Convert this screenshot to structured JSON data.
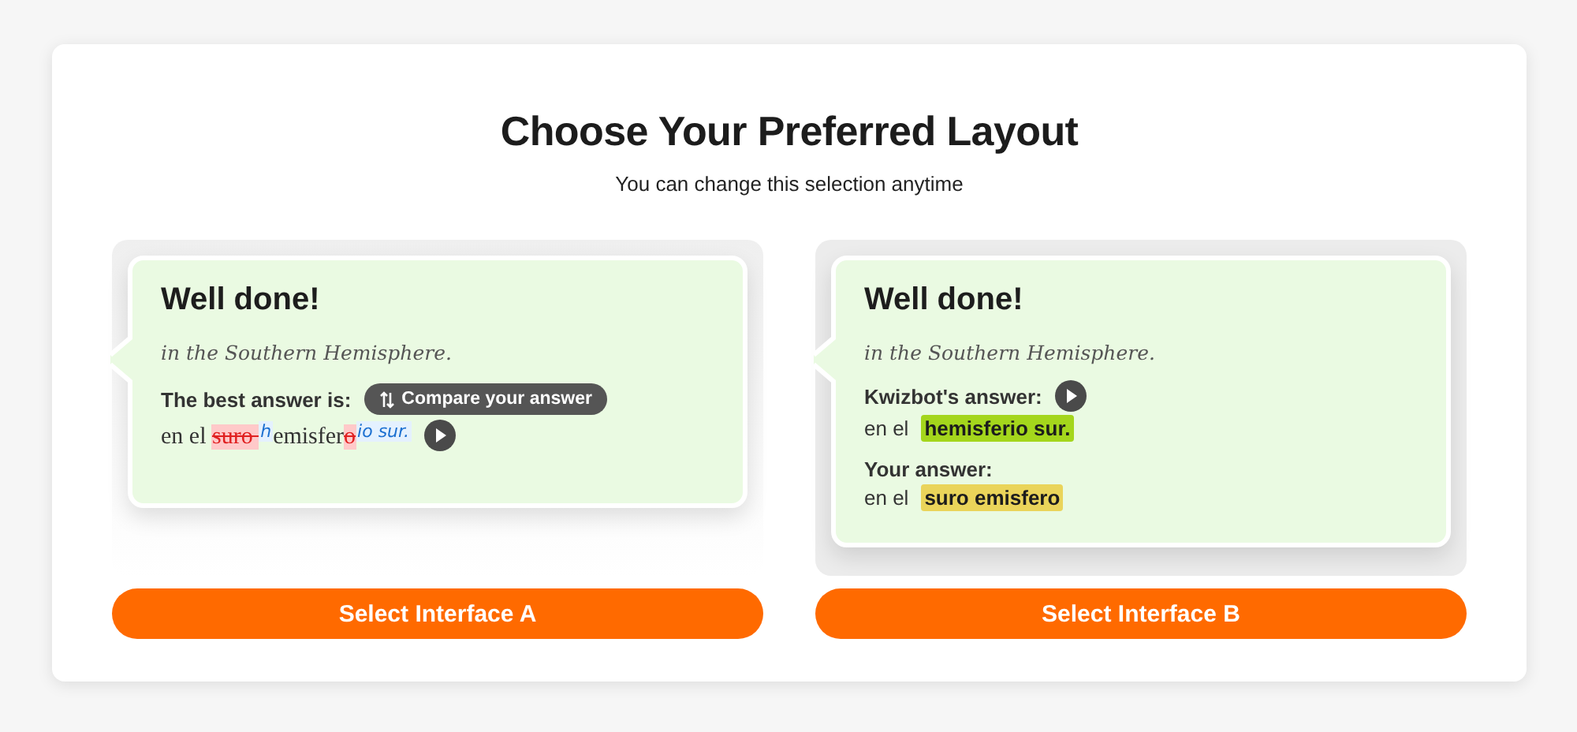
{
  "title": "Choose Your Preferred Layout",
  "subtitle": "You can change this selection anytime",
  "options": [
    {
      "kind": "inline",
      "heading": "Well done!",
      "prompt": "in the Southern Hemisphere.",
      "label": "The best answer is:",
      "compare_button": "Compare your answer",
      "segments": [
        {
          "text": "en el ",
          "kind": "plain"
        },
        {
          "text": "suro ",
          "kind": "deleted"
        },
        {
          "text": "h",
          "kind": "inserted"
        },
        {
          "text": "emisfer",
          "kind": "plain"
        },
        {
          "text": "o",
          "kind": "deleted"
        },
        {
          "text": "io sur.",
          "kind": "inserted"
        }
      ],
      "select_button": "Select Interface A"
    },
    {
      "kind": "split",
      "heading": "Well done!",
      "prompt": "in the Southern Hemisphere.",
      "answers": [
        {
          "label": "Kwizbot's answer:",
          "prefix": "en el",
          "answer": "hemisferio sur.",
          "color": "#a4d61c",
          "audio": true
        },
        {
          "label": "Your answer:",
          "prefix": "en el",
          "answer": "suro emisfero",
          "color": "#ead45a",
          "audio": false
        }
      ],
      "select_button": "Select Interface B"
    }
  ]
}
